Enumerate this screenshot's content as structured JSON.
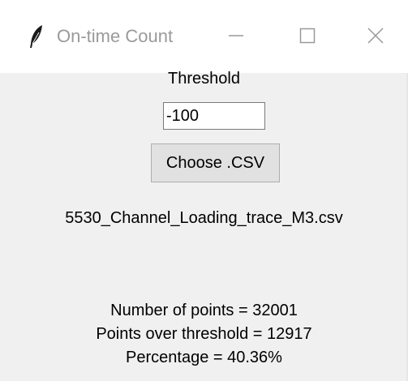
{
  "window": {
    "title": "On-time Count",
    "icon": "feather-icon",
    "controls": [
      "minimize-icon",
      "maximize-icon",
      "close-icon"
    ]
  },
  "threshold": {
    "label": "Threshold",
    "value": "-100"
  },
  "choose_button": {
    "label": "Choose .CSV"
  },
  "file": {
    "name": "5530_Channel_Loading_trace_M3.csv"
  },
  "results": {
    "points": "Number of points = 32001",
    "over_threshold": "Points over threshold = 12917",
    "percentage": "Percentage = 40.36%"
  },
  "colors": {
    "titlebar_bg": "#ffffff",
    "client_bg": "#f0f0f0",
    "button_bg": "#e1e1e1",
    "title_text": "#9a9a9a"
  }
}
